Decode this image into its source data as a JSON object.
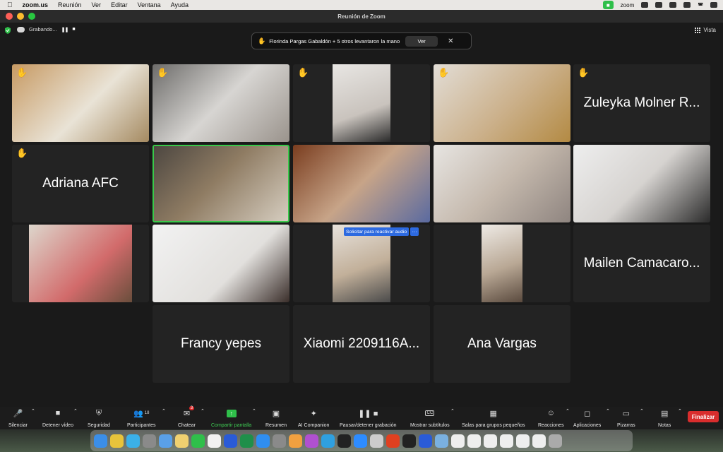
{
  "menubar": {
    "app": "zoom.us",
    "items": [
      "Reunión",
      "Ver",
      "Editar",
      "Ventana",
      "Ayuda"
    ],
    "zoom_label": "zoom"
  },
  "window": {
    "title": "Reunión de Zoom"
  },
  "topstrip": {
    "recording": "Grabando...",
    "view": "Vista"
  },
  "banner": {
    "message": "Florinda Pargas Gabaldón + 5 otros levantaron la mano",
    "button": "Ver"
  },
  "tiles": [
    {
      "name": "",
      "hand": true
    },
    {
      "name": "",
      "hand": true
    },
    {
      "name": "",
      "hand": true
    },
    {
      "name": "",
      "hand": true
    },
    {
      "name": "Zuleyka Molner R...",
      "hand": true
    },
    {
      "name": "Adriana AFC",
      "hand": true
    },
    {
      "name": "",
      "hand": false
    },
    {
      "name": "",
      "hand": false
    },
    {
      "name": "",
      "hand": false
    },
    {
      "name": "",
      "hand": false
    },
    {
      "name": "",
      "hand": false
    },
    {
      "name": "",
      "hand": false
    },
    {
      "name": "",
      "hand": false
    },
    {
      "name": "",
      "hand": false
    },
    {
      "name": "Mailen Camacaro...",
      "hand": false
    },
    {
      "name": "Francy yepes",
      "hand": false
    },
    {
      "name": "Xiaomi 2209116A...",
      "hand": false
    },
    {
      "name": "Ana Vargas",
      "hand": false
    }
  ],
  "reactivar": {
    "label": "Solicitar para reactivar audio",
    "more": "···"
  },
  "toolbar": {
    "silenciar": "Silenciar",
    "detener_video": "Detener vídeo",
    "seguridad": "Seguridad",
    "participantes": "Participantes",
    "participantes_count": "18",
    "chatear": "Chatear",
    "chat_badge": "3",
    "compartir": "Compartir pantalla",
    "resumen": "Resumen",
    "ai": "AI Companion",
    "grabacion": "Pausar/detener grabación",
    "subtitulos": "Mostrar subtítulos",
    "subtitulos_icon": "CC",
    "salas": "Salas para grupos pequeños",
    "reacciones": "Reacciones",
    "aplicaciones": "Aplicaciones",
    "pizarras": "Pizarras",
    "notas": "Notas",
    "finalizar": "Finalizar"
  },
  "colors": {
    "accent_green": "#2fbf4a",
    "end_red": "#d92d2d",
    "audio_blue": "#2d6ae0"
  },
  "dock_apps": [
    "finder",
    "chrome",
    "safari",
    "launchpad",
    "mail",
    "notes",
    "whatsapp",
    "calendar",
    "word-blue",
    "excel",
    "appstore",
    "settings",
    "photos",
    "podcasts",
    "telegram",
    "tv",
    "zoom",
    "search",
    "office",
    "capcut",
    "word",
    "preview",
    "docs1",
    "docs2",
    "docs3",
    "docs4",
    "docs5",
    "docs6",
    "trash"
  ]
}
